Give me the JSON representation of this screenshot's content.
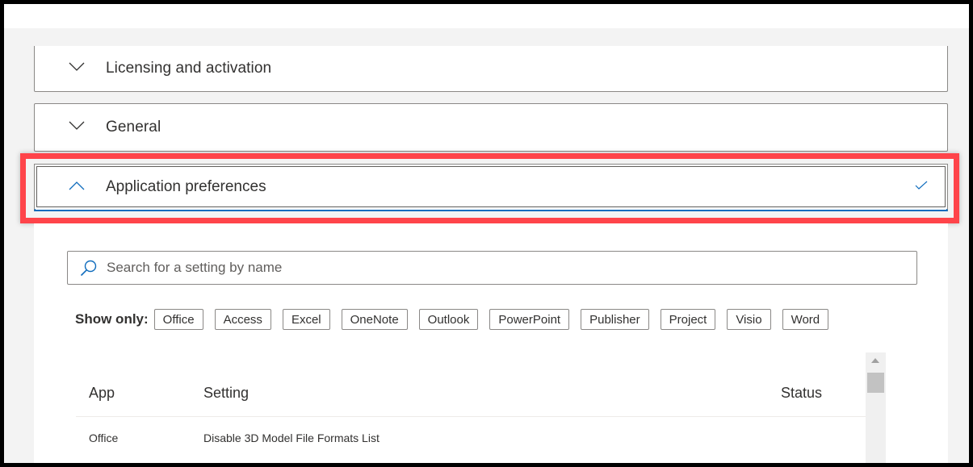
{
  "sections": [
    {
      "title": "Licensing and activation",
      "state": "collapsed"
    },
    {
      "title": "General",
      "state": "collapsed"
    },
    {
      "title": "Application preferences",
      "state": "expanded",
      "completed": true
    }
  ],
  "highlight_color": "#ff444a",
  "accent_color": "#0f6cbd",
  "search": {
    "placeholder": "Search for a setting by name",
    "value": ""
  },
  "filters": {
    "label": "Show only:",
    "options": [
      "Office",
      "Access",
      "Excel",
      "OneNote",
      "Outlook",
      "PowerPoint",
      "Publisher",
      "Project",
      "Visio",
      "Word"
    ]
  },
  "table": {
    "columns": [
      "App",
      "Setting",
      "Status"
    ],
    "rows": [
      {
        "app": "Office",
        "setting": "Disable 3D Model File Formats List",
        "status": ""
      }
    ]
  },
  "icons": {
    "collapsed": "chevron-down-icon",
    "expanded": "chevron-up-icon",
    "completed": "checkmark-icon",
    "search": "search-icon"
  }
}
